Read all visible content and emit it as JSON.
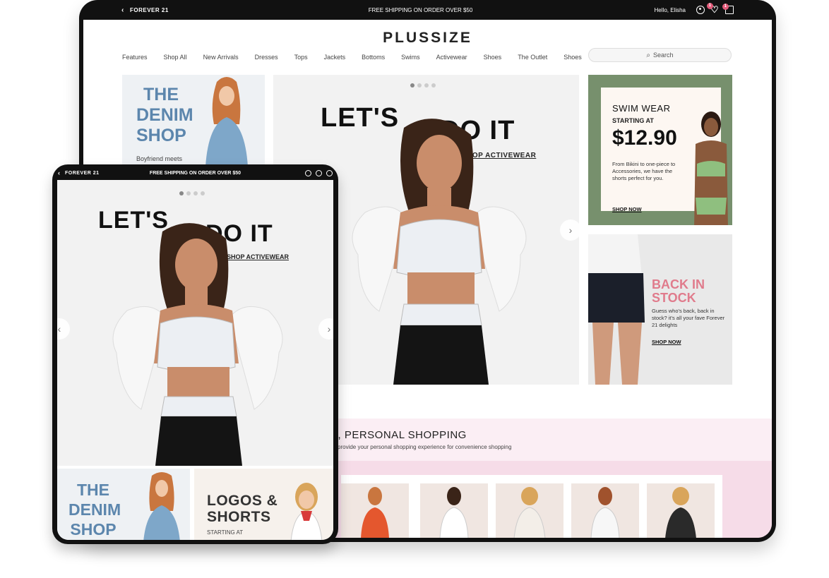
{
  "desktop": {
    "topbar": {
      "back": "‹",
      "brand": "FOREVER 21",
      "shipping": "FREE SHIPPING ON ORDER OVER $50",
      "greeting": "Hello, Elisha",
      "wishlist_count": "1",
      "bag_count": "1"
    },
    "logo": "PLUSSIZE",
    "nav": [
      "Features",
      "Shop All",
      "New Arrivals",
      "Dresses",
      "Tops",
      "Jackets",
      "Bottoms",
      "Swims",
      "Activewear",
      "Shoes",
      "The Outlet",
      "Shoes"
    ],
    "search": {
      "placeholder": "Search"
    },
    "denim": {
      "title": "THE DENIM SHOP",
      "subtitle": "Boyfriend meets"
    },
    "hero": {
      "left": "LET'S",
      "right": "DO IT",
      "link": "SHOP ACTIVEWEAR",
      "arrow": "›"
    },
    "swim": {
      "title": "SWIM WEAR",
      "starting": "STARTING AT",
      "price": "$12.90",
      "desc": "From Bikini to one-piece to Accessories, we have the shorts perfect for you.",
      "shop": "SHOP NOW"
    },
    "back_in_stock": {
      "title": "BACK IN STOCK",
      "desc": "Guess who's back, back in stock? it's all your fave Forever 21 delights",
      "shop": "SHOP NOW"
    },
    "personal": {
      "title": "A, PERSONAL SHOPPING",
      "subtitle": "provide your personal shopping experience for convenience shopping"
    }
  },
  "tablet": {
    "topbar": {
      "back": "‹",
      "brand": "FOREVER 21",
      "shipping": "FREE SHIPPING ON ORDER OVER $50"
    },
    "hero": {
      "left": "LET'S",
      "right": "DO IT",
      "link": "SHOP ACTIVEWEAR",
      "arrow_left": "‹",
      "arrow_right": "›"
    },
    "denim": {
      "title": "THE DENIM SHOP"
    },
    "logos": {
      "title": "LOGOS & SHORTS",
      "subtitle": "STARTING AT"
    }
  },
  "colors": {
    "frame": "#111111",
    "denim": "#5c86ad",
    "accent_pink": "#e07b8c",
    "band_pink": "#fbeef4"
  }
}
